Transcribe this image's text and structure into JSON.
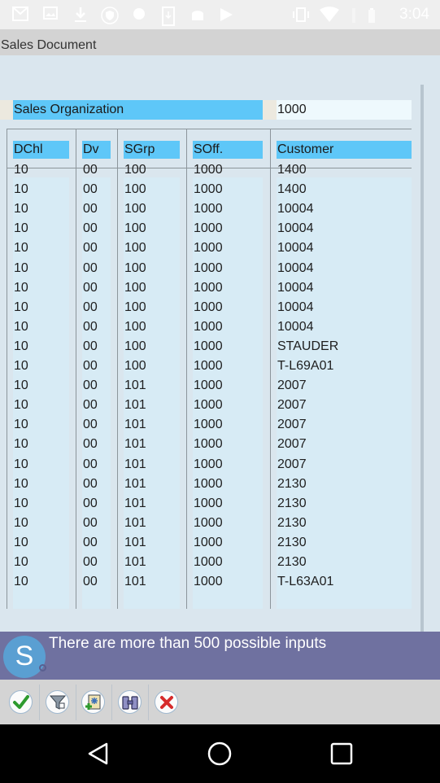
{
  "status_bar": {
    "time": "3:04",
    "left_icons": [
      "gmail-icon",
      "image-icon",
      "download-icon",
      "shield-icon",
      "bug-icon",
      "download-device-icon",
      "android-icon",
      "play-store-icon"
    ],
    "right_icons": [
      "vibrate-icon",
      "wifi-icon",
      "signal-icon",
      "battery-icon"
    ]
  },
  "window": {
    "title": "Sales Document"
  },
  "filter": {
    "label": "Sales Organization",
    "value": "1000"
  },
  "table": {
    "columns": [
      "DChl",
      "Dv",
      "SGrp",
      "SOff.",
      "Customer"
    ],
    "rows": [
      [
        "10",
        "00",
        "100",
        "1000",
        "1400"
      ],
      [
        "10",
        "00",
        "100",
        "1000",
        "1400"
      ],
      [
        "10",
        "00",
        "100",
        "1000",
        "10004"
      ],
      [
        "10",
        "00",
        "100",
        "1000",
        "10004"
      ],
      [
        "10",
        "00",
        "100",
        "1000",
        "10004"
      ],
      [
        "10",
        "00",
        "100",
        "1000",
        "10004"
      ],
      [
        "10",
        "00",
        "100",
        "1000",
        "10004"
      ],
      [
        "10",
        "00",
        "100",
        "1000",
        "10004"
      ],
      [
        "10",
        "00",
        "100",
        "1000",
        "10004"
      ],
      [
        "10",
        "00",
        "100",
        "1000",
        "STAUDER"
      ],
      [
        "10",
        "00",
        "100",
        "1000",
        "T-L69A01"
      ],
      [
        "10",
        "00",
        "101",
        "1000",
        "2007"
      ],
      [
        "10",
        "00",
        "101",
        "1000",
        "2007"
      ],
      [
        "10",
        "00",
        "101",
        "1000",
        "2007"
      ],
      [
        "10",
        "00",
        "101",
        "1000",
        "2007"
      ],
      [
        "10",
        "00",
        "101",
        "1000",
        "2007"
      ],
      [
        "10",
        "00",
        "101",
        "1000",
        "2130"
      ],
      [
        "10",
        "00",
        "101",
        "1000",
        "2130"
      ],
      [
        "10",
        "00",
        "101",
        "1000",
        "2130"
      ],
      [
        "10",
        "00",
        "101",
        "1000",
        "2130"
      ],
      [
        "10",
        "00",
        "101",
        "1000",
        "2130"
      ],
      [
        "10",
        "00",
        "101",
        "1000",
        "T-L63A01"
      ]
    ]
  },
  "message": {
    "avatar_letter": "S",
    "text": "There are more than 500 possible inputs"
  },
  "toolbar": {
    "buttons": [
      {
        "name": "confirm-button",
        "icon": "checkmark-icon"
      },
      {
        "name": "filter-button",
        "icon": "funnel-icon"
      },
      {
        "name": "new-entry-button",
        "icon": "new-document-icon"
      },
      {
        "name": "find-button",
        "icon": "binoculars-icon"
      },
      {
        "name": "cancel-button",
        "icon": "close-icon"
      }
    ]
  },
  "colors": {
    "header_highlight": "#5ec7f8",
    "message_bar": "#6f71a0",
    "avatar": "#5a9fd2"
  }
}
